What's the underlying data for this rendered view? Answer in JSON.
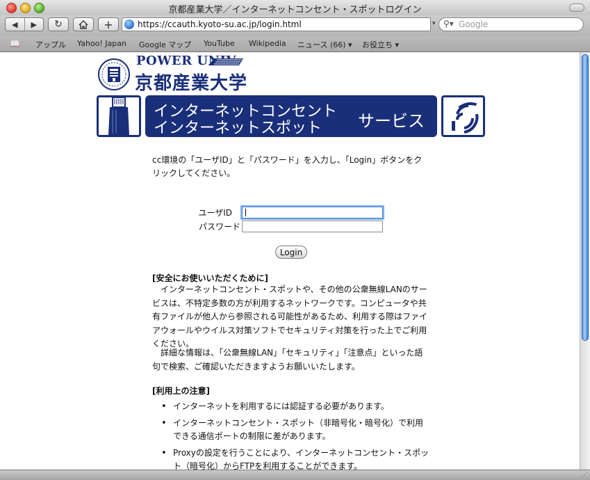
{
  "window": {
    "title": "京都産業大学／インターネットコンセント・スポットログイン"
  },
  "toolbar": {
    "back_glyph": "◀",
    "forward_glyph": "▶",
    "reload_glyph": "↻",
    "home_glyph": "⌂",
    "add_bookmark_glyph": "+",
    "url": "https://ccauth.kyoto-su.ac.jp/login.html",
    "search_placeholder": "Google"
  },
  "bookmarks": {
    "items": [
      "アップル",
      "Yahoo! Japan",
      "Google マップ",
      "YouTube",
      "Wikipedia",
      "ニュース (66)",
      "お役立ち"
    ]
  },
  "logo": {
    "power_text": "POWER UNIV.",
    "university_name": "京都産業大学"
  },
  "banner": {
    "line1": "インターネットコンセント",
    "line2": "インターネットスポット",
    "service": "サービス"
  },
  "intro_text": "cc環境の「ユーザID」と「パスワード」を入力し、「Login」ボタンをクリックしてください。",
  "form": {
    "userid_label": "ユーザID",
    "userid_value": "",
    "password_label": "パスワード",
    "password_value": "",
    "login_button": "Login"
  },
  "safety": {
    "heading": "[安全にお使いいただくために]",
    "paragraph1": "　インターネットコンセント・スポットや、その他の公衆無線LANのサービスは、不特定多数の方が利用するネットワークです。コンピュータや共有ファイルが他人から参照される可能性があるため、利用する際はファイアウォールやウイルス対策ソフトでセキュリティ対策を行った上でご利用ください。",
    "paragraph2": "　詳細な情報は、「公衆無線LAN」「セキュリティ」「注意点」といった語句で検索、ご確認いただきますようお願いいたします。"
  },
  "notes": {
    "heading": "[利用上の注意]",
    "items": [
      "インターネットを利用するには認証する必要があります。",
      "インターネットコンセント・スポット（非暗号化・暗号化）で利用できる通信ポートの制限に差があります。",
      "Proxyの設定を行うことにより、インターネットコンセント・スポット（暗号化）からFTPを利用することができます。"
    ]
  },
  "colors": {
    "brand_navy": "#1a2f7a",
    "scroll_blue": "#5c9be5"
  }
}
